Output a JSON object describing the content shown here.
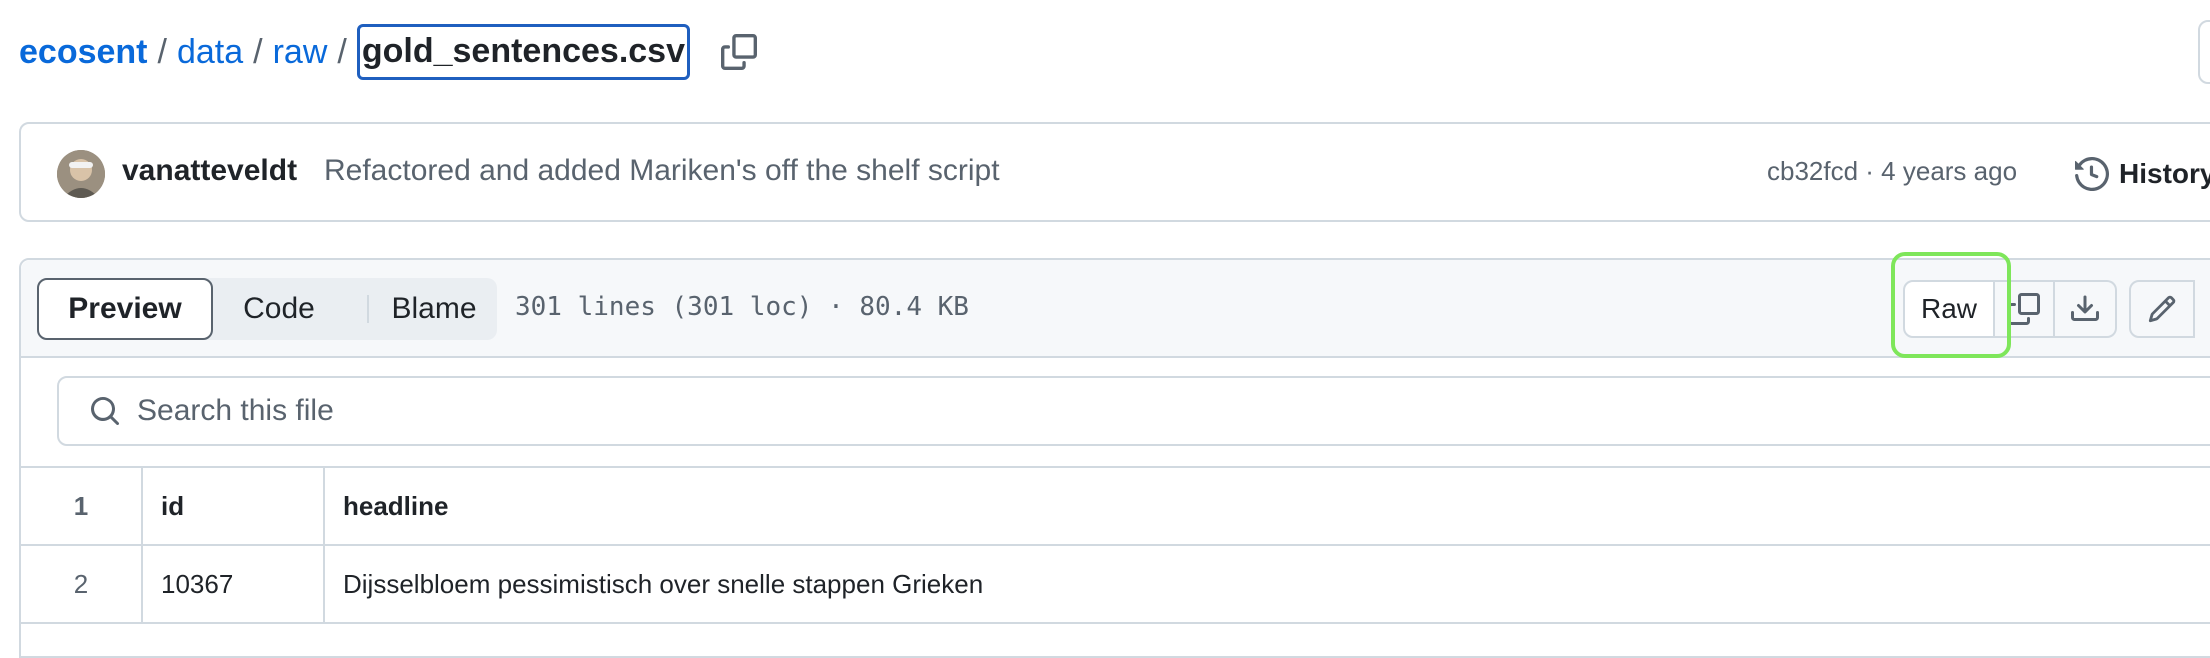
{
  "breadcrumb": {
    "repo": "ecosent",
    "sep": "/",
    "folders": [
      "data",
      "raw"
    ],
    "file": "gold_sentences.csv"
  },
  "commit": {
    "author": "vanatteveldt",
    "message": "Refactored and added Mariken's off the shelf script",
    "meta": "cb32fcd · 4 years ago",
    "history_label": "History"
  },
  "file_header": {
    "tabs": [
      "Preview",
      "Code",
      "Blame"
    ],
    "selected_tab": "Preview",
    "stats": "301 lines (301 loc) · 80.4 KB",
    "raw_label": "Raw"
  },
  "search": {
    "placeholder": "Search this file"
  },
  "table": {
    "header_line": "1",
    "columns": [
      "id",
      "headline"
    ],
    "rows": [
      {
        "line": "2",
        "id": "10367",
        "headline": "Dijsselbloem pessimistisch over snelle stappen Grieken"
      }
    ]
  },
  "colors": {
    "link": "#0969da",
    "raw_highlight": "#7ee65a",
    "focus_border": "#1f5fbf"
  },
  "icons": [
    "copy-icon",
    "history-icon",
    "download-icon",
    "pencil-icon",
    "search-icon"
  ]
}
